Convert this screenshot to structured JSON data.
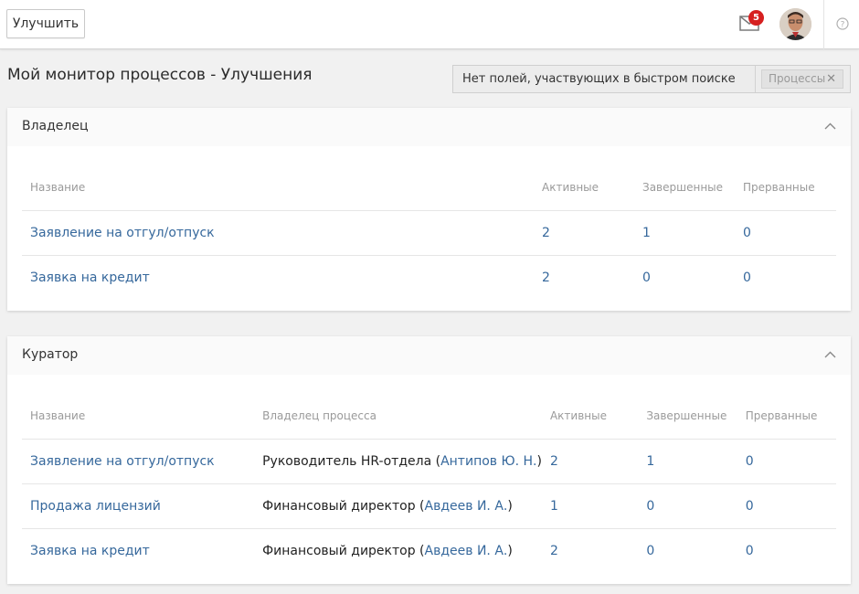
{
  "topbar": {
    "improve_button": "Улучшить",
    "mail_count": "5",
    "icons": {
      "mail": "envelope-icon",
      "help": "question-circle-icon",
      "avatar": "user-avatar"
    }
  },
  "page": {
    "title": "Мой монитор процессов - Улучшения",
    "quick_search": {
      "text": "Нет полей, участвующих в быстром поиске",
      "chip": "Процессы",
      "chip_close": "✕"
    }
  },
  "owner_panel": {
    "title": "Владелец",
    "columns": [
      "Название",
      "Активные",
      "Завершенные",
      "Прерванные"
    ],
    "rows": [
      {
        "name": "Заявление на отгул/отпуск",
        "active": "2",
        "completed": "1",
        "aborted": "0"
      },
      {
        "name": "Заявка на кредит",
        "active": "2",
        "completed": "0",
        "aborted": "0"
      }
    ]
  },
  "curator_panel": {
    "title": "Куратор",
    "columns": [
      "Название",
      "Владелец процесса",
      "Активные",
      "Завершенные",
      "Прерванные"
    ],
    "rows": [
      {
        "name": "Заявление на отгул/отпуск",
        "owner_role": "Руководитель HR-отдела (",
        "owner_person": "Антипов Ю. Н.",
        "owner_close": ")",
        "active": "2",
        "completed": "1",
        "aborted": "0"
      },
      {
        "name": "Продажа лицензий",
        "owner_role": "Финансовый директор (",
        "owner_person": "Авдеев И. А.",
        "owner_close": ")",
        "active": "1",
        "completed": "0",
        "aborted": "0"
      },
      {
        "name": "Заявка на кредит",
        "owner_role": "Финансовый директор (",
        "owner_person": "Авдеев И. А.",
        "owner_close": ")",
        "active": "2",
        "completed": "0",
        "aborted": "0"
      }
    ]
  },
  "colors": {
    "link": "#36689c",
    "badge": "#d62020",
    "background": "#f1f1f1"
  }
}
